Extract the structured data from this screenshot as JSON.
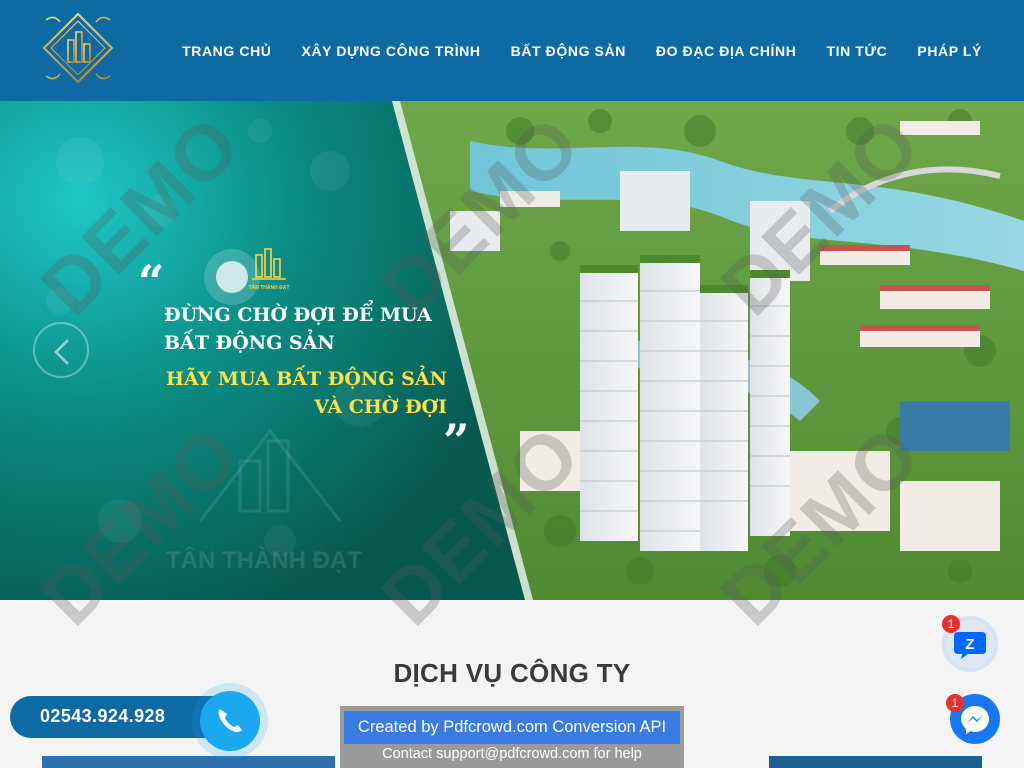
{
  "header": {
    "logo_name": "company-logo",
    "nav": [
      {
        "label": "TRANG CHỦ"
      },
      {
        "label": "XÂY DỰNG CÔNG TRÌNH"
      },
      {
        "label": "BẤT ĐỘNG SẢN"
      },
      {
        "label": "ĐO ĐẠC ĐỊA CHÍNH"
      },
      {
        "label": "TIN TỨC"
      },
      {
        "label": "PHÁP LÝ"
      }
    ]
  },
  "hero": {
    "quote_open": "“",
    "quote_close": "”",
    "line1": "ĐỪNG CHỜ ĐỢI ĐỂ MUA",
    "line2": "BẤT ĐỘNG SẢN",
    "line3": "HÃY MUA BẤT ĐỘNG SẢN",
    "line4": "VÀ CHỜ ĐỢI",
    "logo_text": "TÂN THÀNH ĐẠT",
    "brand_watermark": "TÂN THÀNH ĐẠT"
  },
  "watermark": "DEMO",
  "services": {
    "title": "DỊCH VỤ CÔNG TY"
  },
  "contact": {
    "phone": "02543.924.928"
  },
  "pdfcrowd": {
    "title": "Created by Pdfcrowd.com Conversion API",
    "contact_prefix": "Contact",
    "email": "support@pdfcrowd.com",
    "contact_suffix": "for help"
  },
  "widgets": {
    "zalo_badge": "1",
    "messenger_badge": "1"
  },
  "colors": {
    "header_bg": "#0e6aa3",
    "accent_yellow": "#ffe14a",
    "pdfcrowd_blue": "#3a7be0"
  }
}
